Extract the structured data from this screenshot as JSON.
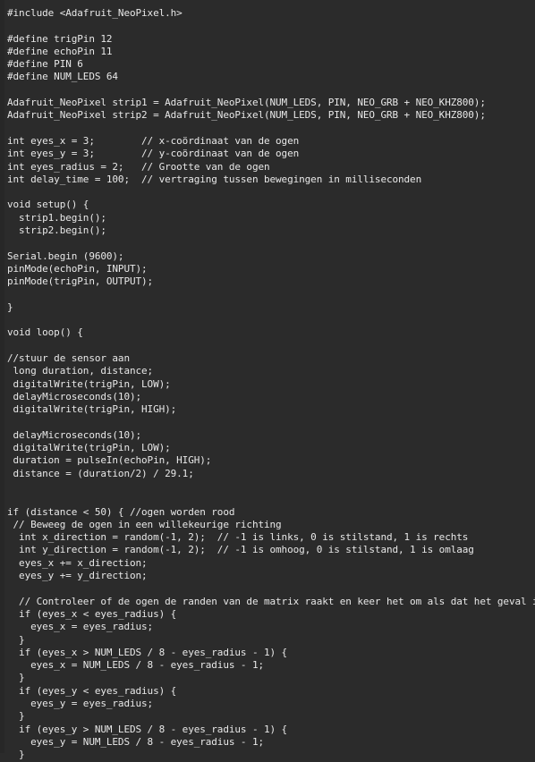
{
  "editor": {
    "background_color": "#2b2b2b",
    "text_color": "#e8e8e8",
    "language": "arduino-cpp",
    "font_size_px": 11,
    "line_height_px": 14.3
  },
  "code": {
    "lines": [
      "#include <Adafruit_NeoPixel.h>",
      "",
      "#define trigPin 12",
      "#define echoPin 11",
      "#define PIN 6",
      "#define NUM_LEDS 64",
      "",
      "Adafruit_NeoPixel strip1 = Adafruit_NeoPixel(NUM_LEDS, PIN, NEO_GRB + NEO_KHZ800);",
      "Adafruit_NeoPixel strip2 = Adafruit_NeoPixel(NUM_LEDS, PIN, NEO_GRB + NEO_KHZ800);",
      "",
      "int eyes_x = 3;        // x-coördinaat van de ogen",
      "int eyes_y = 3;        // y-coördinaat van de ogen",
      "int eyes_radius = 2;   // Grootte van de ogen",
      "int delay_time = 100;  // vertraging tussen bewegingen in milliseconden",
      "",
      "void setup() {",
      "  strip1.begin();",
      "  strip2.begin();",
      "",
      "Serial.begin (9600);",
      "pinMode(echoPin, INPUT);",
      "pinMode(trigPin, OUTPUT);",
      "",
      "}",
      "",
      "void loop() {",
      "",
      "//stuur de sensor aan",
      " long duration, distance;",
      " digitalWrite(trigPin, LOW);",
      " delayMicroseconds(10);",
      " digitalWrite(trigPin, HIGH);",
      "",
      " delayMicroseconds(10);",
      " digitalWrite(trigPin, LOW);",
      " duration = pulseIn(echoPin, HIGH);",
      " distance = (duration/2) / 29.1;",
      "",
      "",
      "if (distance < 50) { //ogen worden rood",
      " // Beweeg de ogen in een willekeurige richting",
      "  int x_direction = random(-1, 2);  // -1 is links, 0 is stilstand, 1 is rechts",
      "  int y_direction = random(-1, 2);  // -1 is omhoog, 0 is stilstand, 1 is omlaag",
      "  eyes_x += x_direction;",
      "  eyes_y += y_direction;",
      "",
      "  // Controleer of de ogen de randen van de matrix raakt en keer het om als dat het geval is",
      "  if (eyes_x < eyes_radius) {",
      "    eyes_x = eyes_radius;",
      "  }",
      "  if (eyes_x > NUM_LEDS / 8 - eyes_radius - 1) {",
      "    eyes_x = NUM_LEDS / 8 - eyes_radius - 1;",
      "  }",
      "  if (eyes_y < eyes_radius) {",
      "    eyes_y = eyes_radius;",
      "  }",
      "  if (eyes_y > NUM_LEDS / 8 - eyes_radius - 1) {",
      "    eyes_y = NUM_LEDS / 8 - eyes_radius - 1;",
      "  }"
    ]
  }
}
